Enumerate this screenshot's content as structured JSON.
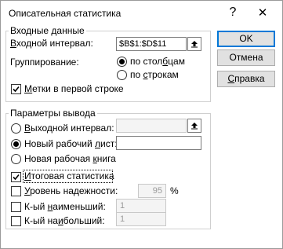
{
  "window": {
    "title": "Описательная статистика",
    "help_glyph": "?",
    "close_glyph": "✕"
  },
  "input_group": {
    "title": "Входные данные",
    "range_label_pre": "",
    "range_label_accel": "В",
    "range_label_post": "ходной интервал:",
    "range_value": "$B$1:$D$11",
    "grouping_label": "Группирование:",
    "group_by_columns_pre": "по стол",
    "group_by_columns_accel": "б",
    "group_by_columns_post": "цам",
    "group_by_columns_selected": true,
    "group_by_rows_pre": "по ",
    "group_by_rows_accel": "с",
    "group_by_rows_post": "трокам",
    "group_by_rows_selected": false,
    "labels_first_row_accel": "М",
    "labels_first_row_post": "етки в первой строке",
    "labels_first_row_checked": true
  },
  "output_group": {
    "title": "Параметры вывода",
    "output_range_accel": "В",
    "output_range_post": "ыходной интервал:",
    "output_range_selected": false,
    "output_range_value": "",
    "new_sheet_pre": "Новый рабочий ",
    "new_sheet_accel": "л",
    "new_sheet_post": "ист:",
    "new_sheet_selected": true,
    "new_sheet_value": "",
    "new_book_pre": "Новая рабочая ",
    "new_book_accel": "к",
    "new_book_post": "нига",
    "new_book_selected": false,
    "summary_accel": "И",
    "summary_post": "тоговая статистика",
    "summary_checked": true,
    "confidence_accel": "У",
    "confidence_post": "ровень надежности:",
    "confidence_checked": false,
    "confidence_value": "95",
    "confidence_unit": "%",
    "kth_smallest_pre": "К-ый ",
    "kth_smallest_accel": "н",
    "kth_smallest_post": "аименьший:",
    "kth_smallest_checked": false,
    "kth_smallest_value": "1",
    "kth_largest_pre": "К-ый на",
    "kth_largest_accel": "и",
    "kth_largest_post": "больший:",
    "kth_largest_checked": false,
    "kth_largest_value": "1"
  },
  "buttons": {
    "ok": "OK",
    "cancel": "Отмена",
    "help_accel": "С",
    "help_post": "правка"
  },
  "colors": {
    "default_button_border": "#0078d7",
    "button_face": "#e1e1e1",
    "group_border": "#cfcfcf"
  },
  "icons": {
    "collapse_dialog": "collapse-dialog-icon",
    "help": "help-icon",
    "close": "close-icon"
  }
}
